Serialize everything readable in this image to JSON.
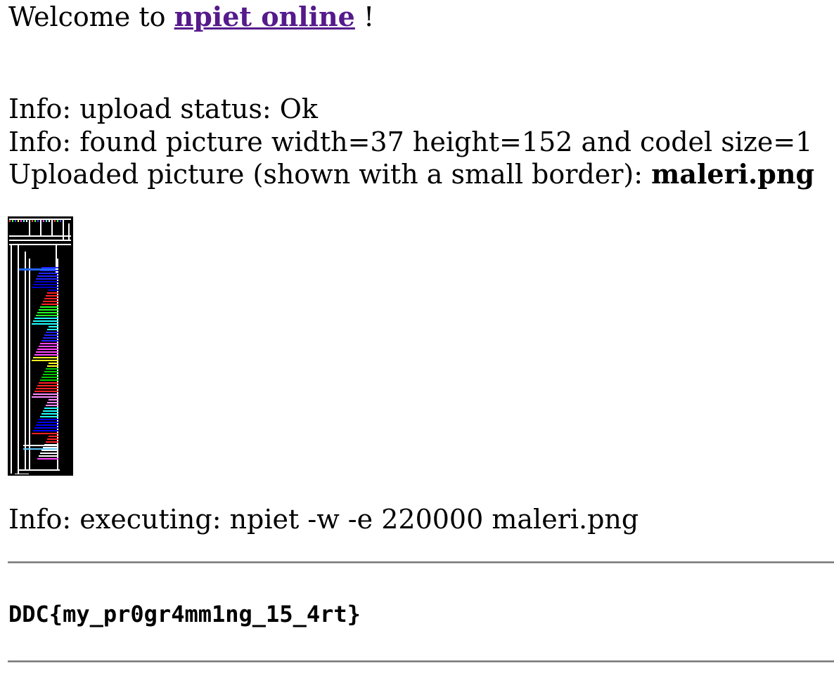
{
  "header": {
    "welcome_prefix": "Welcome to",
    "link_text": "npiet online",
    "welcome_suffix": "!"
  },
  "info": {
    "upload_status": "Info: upload status: Ok",
    "picture_info": "Info: found picture width=37 height=152 and codel size=1",
    "uploaded_prefix": "Uploaded picture (shown with a small border):",
    "filename": "maleri.png"
  },
  "execution": {
    "command_text": "Info: executing: npiet -w -e 220000 maleri.png"
  },
  "output": {
    "flag": "DDC{my_pr0gr4mm1ng_15_4rt}"
  },
  "colors": {
    "link": "#551a8b",
    "rule": "#777777",
    "image_background": "#000000"
  }
}
